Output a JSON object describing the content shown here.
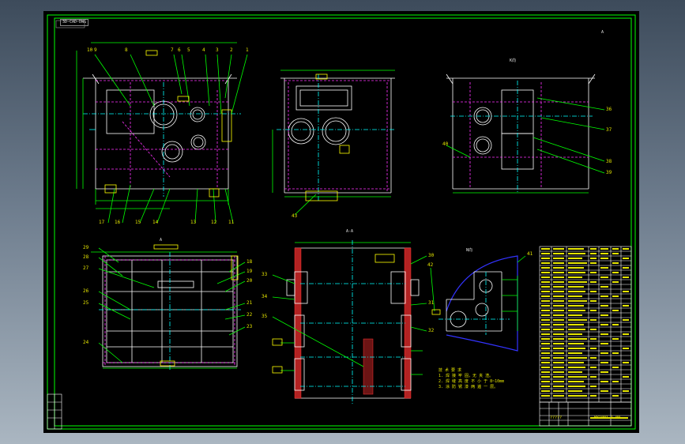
{
  "viewport": {
    "title_tag": "3D-CAD-DWG",
    "background": "#000000",
    "frame_color": "#00ff00"
  },
  "views": {
    "top_right_label": "K向",
    "section_label": "A-A",
    "bottom_left_label": "A",
    "detail_label": "N向",
    "mark_top": "A"
  },
  "part_numbers": {
    "front": [
      "10",
      "9",
      "8",
      "7",
      "6",
      "5",
      "4",
      "3",
      "2",
      "1"
    ],
    "front_bottom": [
      "17",
      "16",
      "15",
      "14",
      "13",
      "12",
      "11"
    ],
    "side_bottom": "43",
    "right": [
      "36",
      "37",
      "38",
      "39",
      "40"
    ],
    "plan_left": [
      "29",
      "28",
      "27",
      "26",
      "25",
      "24"
    ],
    "plan_right": [
      "18",
      "19",
      "20",
      "21",
      "22",
      "23"
    ],
    "section_left": [
      "33",
      "34",
      "35"
    ],
    "section_right": [
      "30",
      "31",
      "32"
    ],
    "detail": [
      "42",
      "41"
    ]
  },
  "notes": {
    "title": "技 术 要 求",
    "line1": "1. 焊 接 牢 固，无 夹 渣。",
    "line2": "2. 焊 缝 高 度 不 小 于 8~10mm",
    "line3": "3. 涂 防 锈 漆 两 遍 一 层。"
  },
  "title_block": {
    "drawing_number": "HY1001-1-00",
    "stamp": "?????"
  }
}
